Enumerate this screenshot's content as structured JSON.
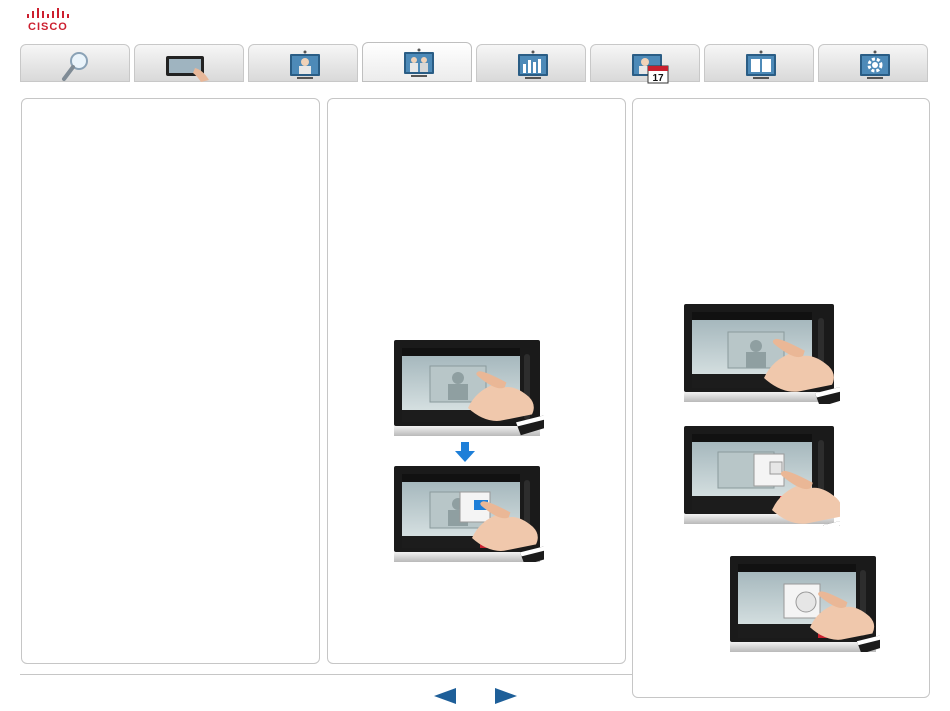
{
  "brand": {
    "logo_text": "CISCO",
    "color": "#cc1f2f"
  },
  "tabs": [
    {
      "icon": "magnifier-icon",
      "active": false
    },
    {
      "icon": "touch-panel-icon",
      "active": false
    },
    {
      "icon": "person-screen-icon",
      "active": false
    },
    {
      "icon": "conference-screen-icon",
      "active": true
    },
    {
      "icon": "chart-screen-icon",
      "active": false
    },
    {
      "icon": "calendar-screen-icon",
      "active": false,
      "calendar_day": "17"
    },
    {
      "icon": "book-screen-icon",
      "active": false
    },
    {
      "icon": "gear-screen-icon",
      "active": false
    }
  ],
  "navigation": {
    "previous": "previous-arrow-icon",
    "next": "next-arrow-icon"
  },
  "colors": {
    "accent_blue": "#1e7fd8",
    "panel_border": "#c6c6c6",
    "end_call_red": "#c8202e"
  }
}
